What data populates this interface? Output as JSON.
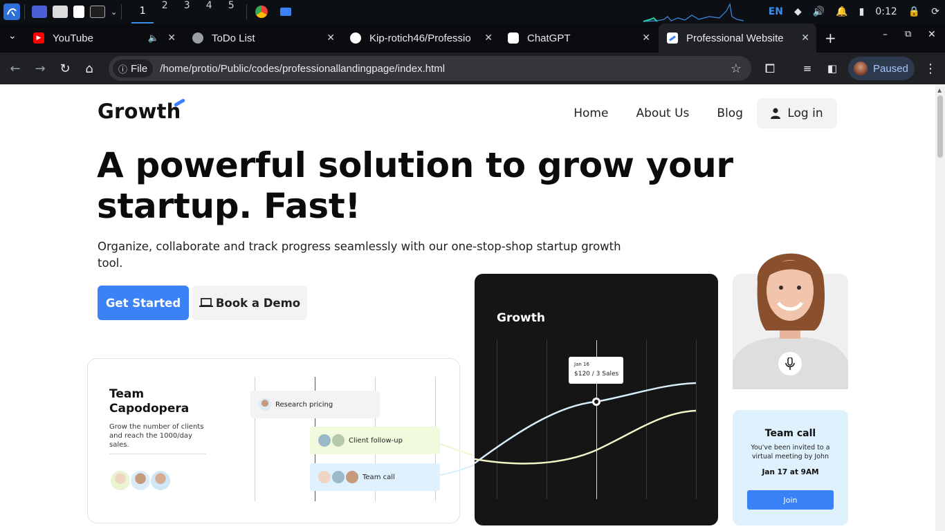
{
  "os_panel": {
    "workspaces": [
      "1",
      "2",
      "3",
      "4",
      "5"
    ],
    "active_workspace": "1",
    "language": "EN",
    "clock": "0:12"
  },
  "browser": {
    "tabs": [
      {
        "title": "YouTube",
        "favicon": "youtube-icon",
        "color": "#ff0000"
      },
      {
        "title": "ToDo List",
        "favicon": "globe-icon",
        "color": "#9aa0a6"
      },
      {
        "title": "Kip-rotich46/Professio",
        "favicon": "github-icon",
        "color": "#ffffff"
      },
      {
        "title": "ChatGPT",
        "favicon": "chatgpt-icon",
        "color": "#ffffff"
      },
      {
        "title": "Professional Website",
        "favicon": "growth-icon",
        "color": "#3b82f6"
      }
    ],
    "address": {
      "chip": "File",
      "url": "/home/protio/Public/codes/professionallandingpage/index.html"
    },
    "profile_status": "Paused"
  },
  "site": {
    "logo": "Growth",
    "nav": {
      "home": "Home",
      "about": "About Us",
      "blog": "Blog",
      "login": "Log in"
    },
    "hero": {
      "title": "A powerful solution to grow your startup. Fast!",
      "subtitle": "Organize, collaborate and track progress seamlessly with our one-stop-shop startup growth tool.",
      "cta_primary": "Get Started",
      "cta_secondary": "Book a Demo"
    },
    "team_card": {
      "title": "Team Capodopera",
      "description": "Grow the number of clients and reach the 1000/day sales.",
      "tasks": [
        "Research pricing",
        "Client follow-up",
        "Team call"
      ]
    },
    "growth_card": {
      "title": "Growth",
      "tooltip_date": "Jan 16",
      "tooltip_value": "$120 / 3 Sales"
    },
    "call_card": {
      "title": "Team call",
      "text": "You've been invited to a virtual meeting by John",
      "date": "Jan 17 at 9AM",
      "join": "Join"
    }
  },
  "colors": {
    "accent": "#3b82f6",
    "dark_card": "#151515",
    "call_card": "#dff1fd"
  }
}
